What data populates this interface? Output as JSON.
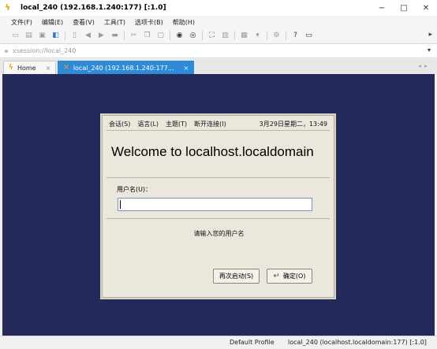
{
  "window": {
    "title": "local_240 (192.168.1.240:177) [:1.0]",
    "minimize": "−",
    "maximize": "□",
    "close": "✕"
  },
  "menubar": {
    "items": [
      "文件(F)",
      "编辑(E)",
      "查看(V)",
      "工具(T)",
      "选项卡(B)",
      "帮助(H)"
    ]
  },
  "address": {
    "value": "xsession://local_240"
  },
  "tabs": [
    {
      "label": "Home",
      "active": false
    },
    {
      "label": "local_240 (192.168.1.240:177...",
      "active": true
    }
  ],
  "dialog": {
    "menu": [
      "会话(S)",
      "语言(L)",
      "主题(T)",
      "断开连接(I)"
    ],
    "clock": "3月29日星期二，13:49",
    "welcome": "Welcome to localhost.localdomain",
    "username_label": "用户名(U)：",
    "username_value": "",
    "hint": "请输入您的用户名",
    "restart_button": "再次启动(S)",
    "ok_button": "确定(O)"
  },
  "statusbar": {
    "profile": "Default Profile",
    "session": "local_240 (localhost.localdomain:177) [:1.0]"
  },
  "colors": {
    "desktop": "#232a5a",
    "active_tab": "#2f8ad8",
    "dialog_bg": "#ece7dc"
  }
}
